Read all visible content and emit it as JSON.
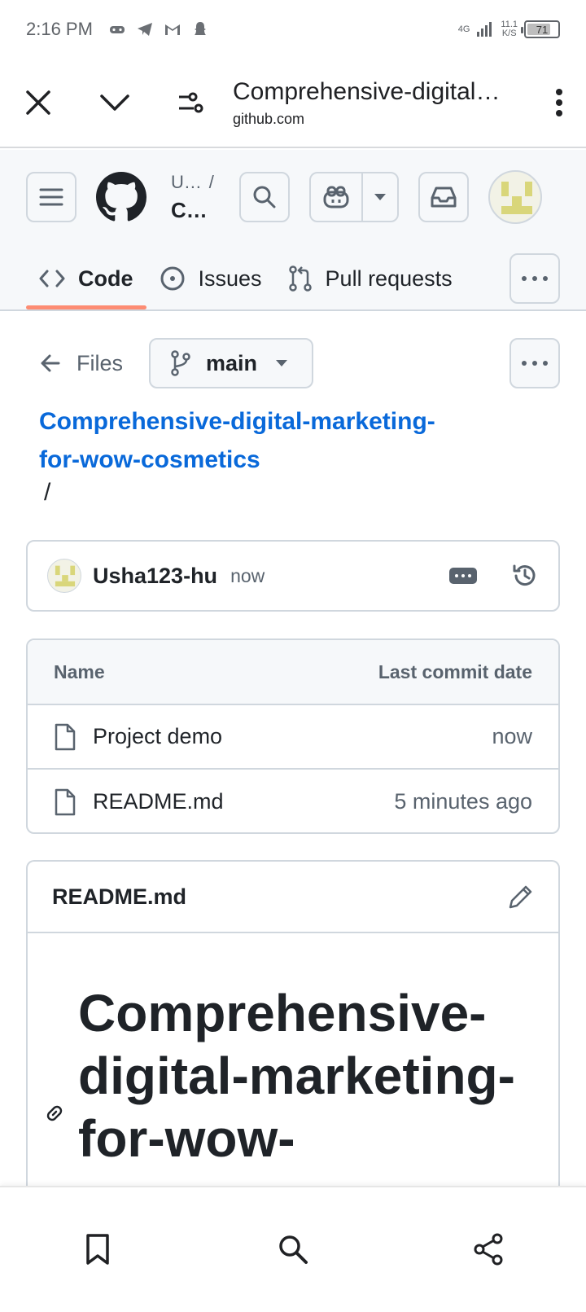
{
  "status_bar": {
    "time": "2:16 PM",
    "network_type": "4G",
    "speed_value": "11.1",
    "speed_unit": "K/S",
    "battery": "71"
  },
  "custom_tab": {
    "title": "Comprehensive-digital…",
    "url": "github.com"
  },
  "github_header": {
    "owner": "U…",
    "owner_sep": "/",
    "repo": "C…",
    "tabs": [
      {
        "label": "Code",
        "active": true
      },
      {
        "label": "Issues",
        "active": false
      },
      {
        "label": "Pull requests",
        "active": false
      }
    ]
  },
  "files_bar": {
    "back_label": "Files",
    "branch": "main"
  },
  "repo": {
    "name_line1": "Comprehensive-digital-marketing-",
    "name_line2": "for-wow-cosmetics",
    "path_sep": "/"
  },
  "latest_commit": {
    "user": "Usha123-hu",
    "time": "now"
  },
  "file_table": {
    "col_name": "Name",
    "col_date": "Last commit date",
    "rows": [
      {
        "name": "Project demo",
        "date": "now"
      },
      {
        "name": "README.md",
        "date": "5 minutes ago"
      }
    ]
  },
  "readme": {
    "header": "README.md",
    "title_line1": "Comprehensive-",
    "title_line2": "digital-marketing-",
    "title_line3": "for-wow-"
  },
  "colors": {
    "link": "#0969da",
    "tab_underline": "#fd8c73",
    "border": "#d0d7de",
    "muted": "#59636e"
  }
}
